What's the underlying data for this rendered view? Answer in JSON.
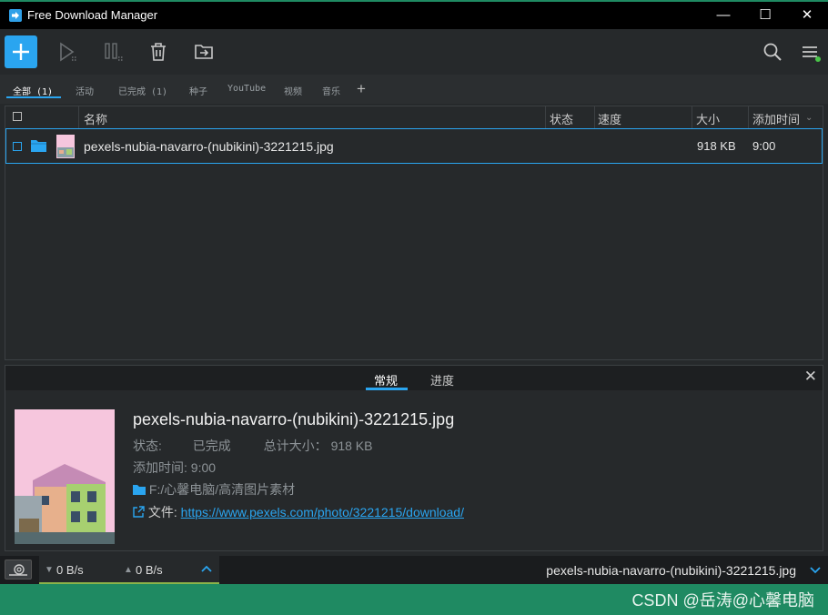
{
  "window": {
    "title": "Free Download Manager",
    "minimize": "—",
    "maximize": "☐",
    "close": "✕"
  },
  "tabs": [
    {
      "label": "全部 (1)"
    },
    {
      "label": "活动"
    },
    {
      "label": "已完成 (1)"
    },
    {
      "label": "种子"
    },
    {
      "label": "YouTube"
    },
    {
      "label": "视频"
    },
    {
      "label": "音乐"
    }
  ],
  "add_tab_label": "+",
  "columns": {
    "name": "名称",
    "status": "状态",
    "speed": "速度",
    "size": "大小",
    "added": "添加时间"
  },
  "downloads": [
    {
      "name": "pexels-nubia-navarro-(nubikini)-3221215.jpg",
      "size": "918 KB",
      "added": "9:00"
    }
  ],
  "details": {
    "tab_general": "常规",
    "tab_progress": "进度",
    "title": "pexels-nubia-navarro-(nubikini)-3221215.jpg",
    "status_label": "状态:",
    "status_value": "已完成",
    "total_size_label": "总计大小：",
    "total_size_value": "918 KB",
    "added_label": "添加时间:",
    "added_value": "9:00",
    "path": "F:/心馨电脑/高清图片素材",
    "file_label": "文件:",
    "file_url": "https://www.pexels.com/photo/3221215/download/"
  },
  "statusbar": {
    "download_speed": "0 B/s",
    "upload_speed": "0 B/s",
    "current_file": "pexels-nubia-navarro-(nubikini)-3221215.jpg"
  },
  "watermark": "CSDN @岳涛@心馨电脑",
  "colors": {
    "accent": "#2aa5f0",
    "taskbar_green": "#1f8a62"
  }
}
